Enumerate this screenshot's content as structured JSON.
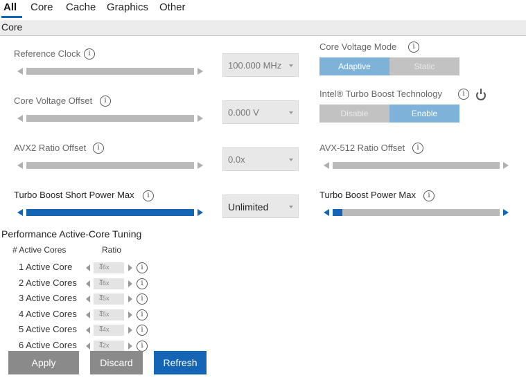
{
  "tabs": [
    "All",
    "Core",
    "Cache",
    "Graphics",
    "Other"
  ],
  "section_title": "Core",
  "left_controls": [
    {
      "label": "Reference Clock",
      "value": "100.000 MHz"
    },
    {
      "label": "Core Voltage Offset",
      "value": "0.000 V"
    },
    {
      "label": "AVX2 Ratio Offset",
      "value": "0.0x"
    },
    {
      "label": "Turbo Boost Short Power Max",
      "value": "Unlimited"
    }
  ],
  "right_controls": {
    "voltage_mode": {
      "label": "Core Voltage Mode",
      "options": [
        "Adaptive",
        "Static"
      ],
      "selected": "Adaptive"
    },
    "turbo_tech": {
      "label": "Intel® Turbo Boost Technology",
      "options": [
        "Disable",
        "Enable"
      ],
      "selected": "Enable"
    },
    "avx512": {
      "label": "AVX-512 Ratio Offset"
    },
    "turbo_power": {
      "label": "Turbo Boost Power Max",
      "level": 0.06
    }
  },
  "tuning": {
    "title": "Performance Active-Core Tuning",
    "col_cores": "# Active Cores",
    "col_ratio": "Ratio",
    "rows": [
      {
        "label": "1 Active Core",
        "ratio": "46x"
      },
      {
        "label": "2 Active Cores",
        "ratio": "46x"
      },
      {
        "label": "3 Active Cores",
        "ratio": "45x"
      },
      {
        "label": "4 Active Cores",
        "ratio": "45x"
      },
      {
        "label": "5 Active Cores",
        "ratio": "44x"
      },
      {
        "label": "6 Active Cores",
        "ratio": "42x"
      }
    ]
  },
  "buttons": {
    "apply": "Apply",
    "discard": "Discard",
    "refresh": "Refresh"
  },
  "icons": {
    "info": "info-icon",
    "power": "power-icon"
  },
  "colors": {
    "accent": "#1565b6",
    "toggle_on": "#7fb2d8",
    "toggle_off": "#c2c2c2",
    "button_grey": "#8a8a8a"
  }
}
